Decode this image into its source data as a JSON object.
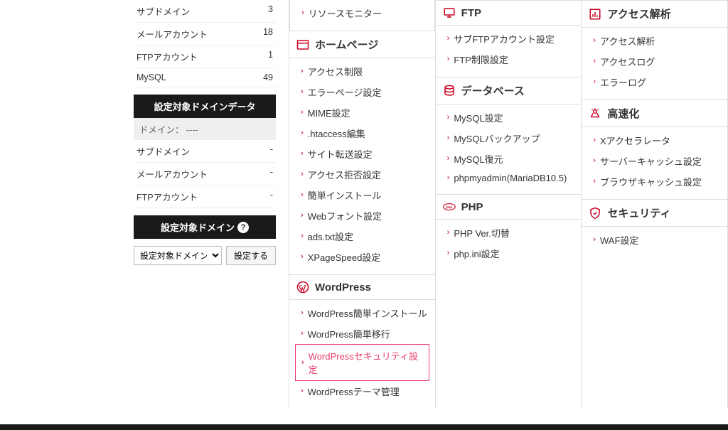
{
  "sidebar": {
    "stats": [
      {
        "label": "サブドメイン",
        "value": "3"
      },
      {
        "label": "メールアカウント",
        "value": "18"
      },
      {
        "label": "FTPアカウント",
        "value": "1"
      },
      {
        "label": "MySQL",
        "value": "49"
      }
    ],
    "domain_data_header": "設定対象ドメインデータ",
    "domain_label": "ドメイン：",
    "domain_value": "----",
    "domain_stats": [
      {
        "label": "サブドメイン",
        "value": "-"
      },
      {
        "label": "メールアカウント",
        "value": "-"
      },
      {
        "label": "FTPアカウント",
        "value": "-"
      }
    ],
    "target_domain_header": "設定対象ドメイン",
    "select_placeholder": "設定対象ドメイン:",
    "set_button": "設定する"
  },
  "columns": {
    "left": {
      "top_links": [
        "リソースモニター"
      ],
      "sections": [
        {
          "icon": "browser",
          "title": "ホームページ",
          "links": [
            "アクセス制限",
            "エラーページ設定",
            "MIME設定",
            ".htaccess編集",
            "サイト転送設定",
            "アクセス拒否設定",
            "簡単インストール",
            "Webフォント設定",
            "ads.txt設定",
            "XPageSpeed設定"
          ]
        },
        {
          "icon": "wordpress",
          "title": "WordPress",
          "links": [
            "WordPress簡単インストール",
            "WordPress簡単移行"
          ],
          "highlighted_link": "WordPressセキュリティ設定",
          "links_after": [
            "WordPressテーマ管理"
          ]
        }
      ]
    },
    "mid": {
      "sections": [
        {
          "icon": "ftp",
          "title": "FTP",
          "links": [
            "サブFTPアカウント設定",
            "FTP制限設定"
          ]
        },
        {
          "icon": "database",
          "title": "データベース",
          "links": [
            "MySQL設定",
            "MySQLバックアップ",
            "MySQL復元",
            "phpmyadmin(MariaDB10.5)"
          ]
        },
        {
          "icon": "php",
          "title": "PHP",
          "links": [
            "PHP Ver.切替",
            "php.ini設定"
          ]
        }
      ]
    },
    "right": {
      "sections": [
        {
          "icon": "chart",
          "title": "アクセス解析",
          "links": [
            "アクセス解析",
            "アクセスログ",
            "エラーログ"
          ]
        },
        {
          "icon": "speed",
          "title": "高速化",
          "links": [
            "Xアクセラレータ",
            "サーバーキャッシュ設定",
            "ブラウザキャッシュ設定"
          ]
        },
        {
          "icon": "security",
          "title": "セキュリティ",
          "links": [
            "WAF設定"
          ]
        }
      ]
    }
  }
}
